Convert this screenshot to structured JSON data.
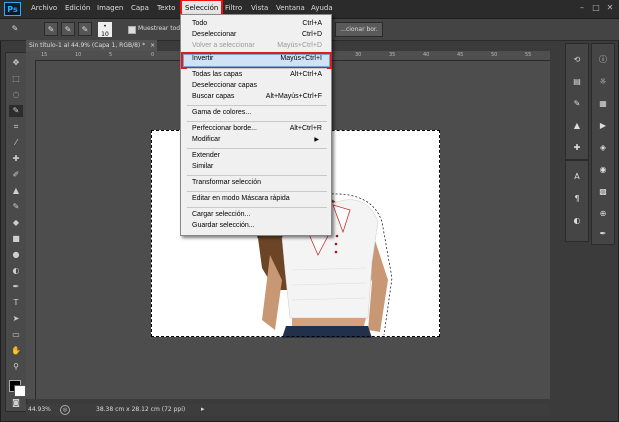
{
  "menubar": {
    "logo": "Ps",
    "items": [
      "Archivo",
      "Edición",
      "Imagen",
      "Capa",
      "Texto",
      "Selección",
      "Filtro",
      "Vista",
      "Ventana",
      "Ayuda"
    ],
    "active": "Selección"
  },
  "options": {
    "brush_size": "10",
    "show_all_label": "Muestrear todas",
    "refine_button": "...cionar bor."
  },
  "document": {
    "tab_title": "Sin título-1 al 44.9% (Capa 1, RGB/8) *",
    "close": "×",
    "ruler_numbers": [
      "15",
      "10",
      "5",
      "0",
      "5",
      "10",
      "15",
      "20",
      "25",
      "30",
      "35",
      "40",
      "45",
      "50",
      "55"
    ]
  },
  "status": {
    "zoom": "44.93%",
    "size": "38.38 cm x 28.12 cm (72 ppi)"
  },
  "menu": {
    "items": [
      {
        "label": "Todo",
        "shortcut": "Ctrl+A"
      },
      {
        "label": "Deseleccionar",
        "shortcut": "Ctrl+D"
      },
      {
        "label": "Volver a seleccionar",
        "shortcut": "Mayús+Ctrl+D"
      },
      {
        "label": "Invertir",
        "shortcut": "Mayús+Ctrl+I"
      },
      {
        "label": "Todas las capas",
        "shortcut": "Alt+Ctrl+A"
      },
      {
        "label": "Deseleccionar capas",
        "shortcut": ""
      },
      {
        "label": "Buscar capas",
        "shortcut": "Alt+Mayús+Ctrl+F"
      },
      {
        "label": "Gama de colores...",
        "shortcut": ""
      },
      {
        "label": "Perfeccionar borde...",
        "shortcut": "Alt+Ctrl+R"
      },
      {
        "label": "Modificar",
        "shortcut": ""
      },
      {
        "label": "Extender",
        "shortcut": ""
      },
      {
        "label": "Similar",
        "shortcut": ""
      },
      {
        "label": "Transformar selección",
        "shortcut": ""
      },
      {
        "label": "Editar en modo Máscara rápida",
        "shortcut": ""
      },
      {
        "label": "Cargar selección...",
        "shortcut": ""
      },
      {
        "label": "Guardar selección...",
        "shortcut": ""
      }
    ]
  }
}
